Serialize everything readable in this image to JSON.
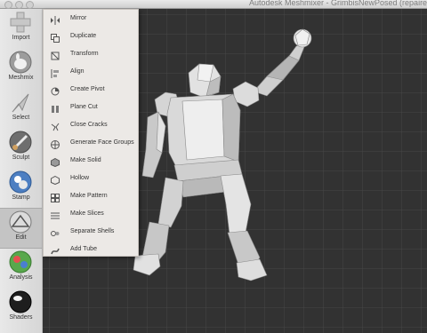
{
  "window": {
    "title": "Autodesk Meshmixer - GrimbisNewPosed (repaired"
  },
  "toolbar": {
    "tools": [
      {
        "label": "Import"
      },
      {
        "label": "Meshmix"
      },
      {
        "label": "Select"
      },
      {
        "label": "Sculpt"
      },
      {
        "label": "Stamp"
      },
      {
        "label": "Edit"
      },
      {
        "label": "Analysis"
      },
      {
        "label": "Shaders"
      }
    ]
  },
  "edit_menu": {
    "items": [
      {
        "label": "Mirror",
        "icon": "mirror-icon"
      },
      {
        "label": "Duplicate",
        "icon": "duplicate-icon"
      },
      {
        "label": "Transform",
        "icon": "transform-icon"
      },
      {
        "label": "Align",
        "icon": "align-icon"
      },
      {
        "label": "Create Pivot",
        "icon": "pivot-icon"
      },
      {
        "label": "Plane Cut",
        "icon": "plane-cut-icon"
      },
      {
        "label": "Close Cracks",
        "icon": "close-cracks-icon"
      },
      {
        "label": "Generate Face Groups",
        "icon": "face-groups-icon"
      },
      {
        "label": "Make Solid",
        "icon": "make-solid-icon"
      },
      {
        "label": "Hollow",
        "icon": "hollow-icon"
      },
      {
        "label": "Make Pattern",
        "icon": "pattern-icon"
      },
      {
        "label": "Make Slices",
        "icon": "slices-icon"
      },
      {
        "label": "Separate Shells",
        "icon": "shells-icon"
      },
      {
        "label": "Add Tube",
        "icon": "tube-icon"
      }
    ]
  },
  "colors": {
    "viewport_background": "#333333",
    "grid_line": "#4a4a4a",
    "toolbar_background": "#e0e0e0",
    "menu_background": "#ece9e6",
    "model": "#d8d8d8"
  }
}
